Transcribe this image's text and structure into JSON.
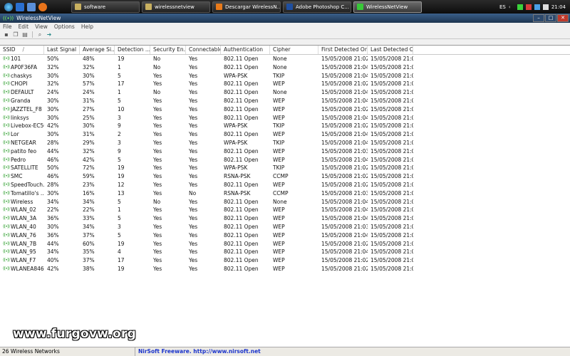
{
  "taskbar": {
    "tasks": [
      {
        "label": "software",
        "color": "#c8b060"
      },
      {
        "label": "wirelessnetview",
        "color": "#c8b060"
      },
      {
        "label": "Descargar WirelessN...",
        "color": "#e87a1a"
      },
      {
        "label": "Adobe Photoshop C...",
        "color": "#1f4fa0"
      },
      {
        "label": "WirelessNetView",
        "color": "#38c838"
      }
    ],
    "language": "ES",
    "clock": "21:04"
  },
  "window": {
    "title": "WirelessNetView",
    "menu": [
      "File",
      "Edit",
      "View",
      "Options",
      "Help"
    ]
  },
  "table": {
    "columns": [
      "SSID",
      "Last Signal",
      "Average Si...",
      "Detection ...",
      "Security En...",
      "Connectable",
      "Authentication",
      "Cipher",
      "First Detected On",
      "Last Detected On"
    ],
    "sort_indicator": "/",
    "rows": [
      [
        "101",
        "50%",
        "48%",
        "19",
        "No",
        "Yes",
        "802.11 Open",
        "None",
        "15/05/2008 21:02...",
        "15/05/2008 21:04..."
      ],
      [
        "AP0F36FA",
        "32%",
        "32%",
        "1",
        "No",
        "Yes",
        "802.11 Open",
        "None",
        "15/05/2008 21:04...",
        "15/05/2008 21:04..."
      ],
      [
        "chaskys",
        "30%",
        "30%",
        "5",
        "Yes",
        "Yes",
        "WPA-PSK",
        "TKIP",
        "15/05/2008 21:04...",
        "15/05/2008 21:04..."
      ],
      [
        "CHOPI",
        "32%",
        "57%",
        "17",
        "Yes",
        "Yes",
        "802.11 Open",
        "WEP",
        "15/05/2008 21:02...",
        "15/05/2008 21:04..."
      ],
      [
        "DEFAULT",
        "24%",
        "24%",
        "1",
        "No",
        "Yes",
        "802.11 Open",
        "None",
        "15/05/2008 21:04...",
        "15/05/2008 21:04..."
      ],
      [
        "Granda",
        "30%",
        "31%",
        "5",
        "Yes",
        "Yes",
        "802.11 Open",
        "WEP",
        "15/05/2008 21:04...",
        "15/05/2008 21:04..."
      ],
      [
        "JAZZTEL_F8",
        "30%",
        "27%",
        "10",
        "Yes",
        "Yes",
        "802.11 Open",
        "WEP",
        "15/05/2008 21:02...",
        "15/05/2008 21:04..."
      ],
      [
        "linksys",
        "30%",
        "25%",
        "3",
        "Yes",
        "Yes",
        "802.11 Open",
        "WEP",
        "15/05/2008 21:04...",
        "15/05/2008 21:04..."
      ],
      [
        "Livebox-EC50",
        "42%",
        "30%",
        "9",
        "Yes",
        "Yes",
        "WPA-PSK",
        "TKIP",
        "15/05/2008 21:02...",
        "15/05/2008 21:04..."
      ],
      [
        "Lor",
        "30%",
        "31%",
        "2",
        "Yes",
        "Yes",
        "802.11 Open",
        "WEP",
        "15/05/2008 21:04...",
        "15/05/2008 21:04..."
      ],
      [
        "NETGEAR",
        "28%",
        "29%",
        "3",
        "Yes",
        "Yes",
        "WPA-PSK",
        "TKIP",
        "15/05/2008 21:04...",
        "15/05/2008 21:04..."
      ],
      [
        "patito feo",
        "44%",
        "32%",
        "9",
        "Yes",
        "Yes",
        "802.11 Open",
        "WEP",
        "15/05/2008 21:03...",
        "15/05/2008 21:04..."
      ],
      [
        "Pedro",
        "46%",
        "42%",
        "5",
        "Yes",
        "Yes",
        "802.11 Open",
        "WEP",
        "15/05/2008 21:04...",
        "15/05/2008 21:04..."
      ],
      [
        "SATELLITE",
        "50%",
        "72%",
        "19",
        "Yes",
        "Yes",
        "WPA-PSK",
        "TKIP",
        "15/05/2008 21:02...",
        "15/05/2008 21:04..."
      ],
      [
        "SMC",
        "46%",
        "59%",
        "19",
        "Yes",
        "Yes",
        "RSNA-PSK",
        "CCMP",
        "15/05/2008 21:02...",
        "15/05/2008 21:04..."
      ],
      [
        "SpeedTouch...",
        "28%",
        "23%",
        "12",
        "Yes",
        "Yes",
        "802.11 Open",
        "WEP",
        "15/05/2008 21:02...",
        "15/05/2008 21:04..."
      ],
      [
        "Tomatillo's ...",
        "30%",
        "16%",
        "13",
        "Yes",
        "No",
        "RSNA-PSK",
        "CCMP",
        "15/05/2008 21:03...",
        "15/05/2008 21:04..."
      ],
      [
        "Wireless",
        "34%",
        "34%",
        "5",
        "No",
        "Yes",
        "802.11 Open",
        "None",
        "15/05/2008 21:04...",
        "15/05/2008 21:04..."
      ],
      [
        "WLAN_02",
        "22%",
        "22%",
        "1",
        "Yes",
        "Yes",
        "802.11 Open",
        "WEP",
        "15/05/2008 21:04...",
        "15/05/2008 21:04..."
      ],
      [
        "WLAN_3A",
        "36%",
        "33%",
        "5",
        "Yes",
        "Yes",
        "802.11 Open",
        "WEP",
        "15/05/2008 21:04...",
        "15/05/2008 21:04..."
      ],
      [
        "WLAN_40",
        "30%",
        "34%",
        "3",
        "Yes",
        "Yes",
        "802.11 Open",
        "WEP",
        "15/05/2008 21:03...",
        "15/05/2008 21:03..."
      ],
      [
        "WLAN_76",
        "36%",
        "37%",
        "5",
        "Yes",
        "Yes",
        "802.11 Open",
        "WEP",
        "15/05/2008 21:04...",
        "15/05/2008 21:04..."
      ],
      [
        "WLAN_7B",
        "44%",
        "60%",
        "19",
        "Yes",
        "Yes",
        "802.11 Open",
        "WEP",
        "15/05/2008 21:02...",
        "15/05/2008 21:04..."
      ],
      [
        "WLAN_95",
        "34%",
        "35%",
        "4",
        "Yes",
        "Yes",
        "802.11 Open",
        "WEP",
        "15/05/2008 21:04...",
        "15/05/2008 21:04..."
      ],
      [
        "WLAN_F7",
        "40%",
        "37%",
        "17",
        "Yes",
        "Yes",
        "802.11 Open",
        "WEP",
        "15/05/2008 21:02...",
        "15/05/2008 21:04..."
      ],
      [
        "WLANEA8464",
        "42%",
        "38%",
        "19",
        "Yes",
        "Yes",
        "802.11 Open",
        "WEP",
        "15/05/2008 21:02...",
        "15/05/2008 21:04..."
      ]
    ]
  },
  "status": {
    "count_text": "26 Wireless Networks",
    "link_text": "NirSoft Freeware.  http://www.nirsoft.net"
  },
  "watermark": "www.furgovw.org",
  "icons": {
    "wifi": "wifi-signal-icon",
    "toolbar": [
      "save-icon",
      "copy-icon",
      "properties-icon",
      "find-icon",
      "exit-icon"
    ]
  }
}
